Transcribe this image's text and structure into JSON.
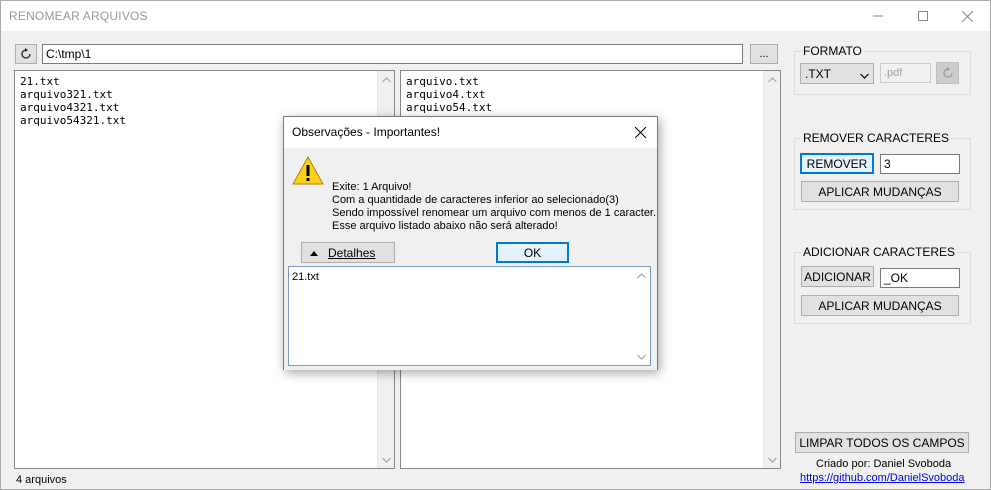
{
  "window": {
    "title": "RENOMEAR ARQUIVOS"
  },
  "path": {
    "value": "C:\\tmp\\1",
    "browse_label": "..."
  },
  "left_list": {
    "items": [
      "21.txt",
      "arquivo321.txt",
      "arquivo4321.txt",
      "arquivo54321.txt"
    ]
  },
  "right_list": {
    "items": [
      "arquivo.txt",
      "arquivo4.txt",
      "arquivo54.txt"
    ]
  },
  "status": {
    "text": "4 arquivos"
  },
  "formato": {
    "legend": "FORMATO",
    "selected": ".TXT",
    "extension_placeholder": ".pdf"
  },
  "remover": {
    "legend": "REMOVER CARACTERES",
    "button_label": "REMOVER",
    "value": "3",
    "apply_label": "APLICAR MUDANÇAS"
  },
  "adicionar": {
    "legend": "ADICIONAR CARACTERES",
    "button_label": "ADICIONAR",
    "value": "_OK",
    "apply_label": "APLICAR MUDANÇAS"
  },
  "footer": {
    "clear_label": "LIMPAR TODOS OS CAMPOS",
    "credit": "Criado por: Daniel Svoboda",
    "link": "https://github.com/DanielSvoboda"
  },
  "dialog": {
    "title": "Observações - Importantes!",
    "lines": [
      "Exite: 1 Arquivo!",
      "Com a quantidade de caracteres inferior ao selecionado(3)",
      "Sendo impossível renomear um arquivo com menos de 1 caracter.",
      "Esse arquivo listado abaixo não será alterado!"
    ],
    "details_label": "Detalhes",
    "ok_label": "OK",
    "details_text": "21.txt"
  },
  "icons": {
    "refresh": "refresh-icon",
    "warning": "warning-icon",
    "close": "close-icon"
  }
}
